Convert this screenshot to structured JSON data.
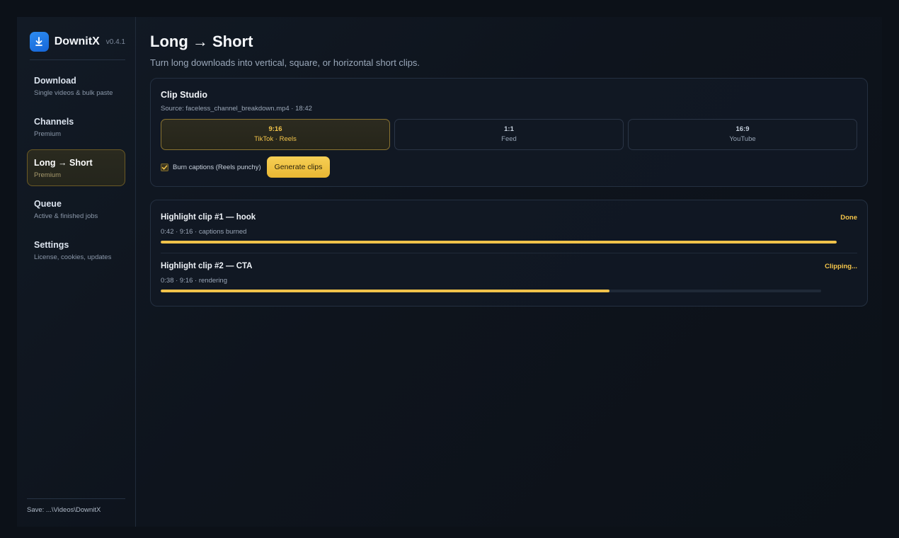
{
  "brand": {
    "name": "DownitX",
    "version": "v0.4.1",
    "logo_icon": "download-arrow-icon",
    "logo_color": "#1f7ae6"
  },
  "nav": {
    "items": [
      {
        "title": "Download",
        "subtitle": "Single videos & bulk paste",
        "active": false
      },
      {
        "title": "Channels",
        "subtitle": "Premium",
        "active": false
      },
      {
        "title": "Long → Short",
        "subtitle": "Premium",
        "active": true
      },
      {
        "title": "Queue",
        "subtitle": "Active & finished jobs",
        "active": false
      },
      {
        "title": "Settings",
        "subtitle": "License, cookies, updates",
        "active": false
      }
    ]
  },
  "footer": {
    "save_path": "Save: ...\\Videos\\DownitX"
  },
  "page": {
    "title": "Long → Short",
    "subtitle": "Turn long downloads into vertical, square, or horizontal short clips."
  },
  "studio": {
    "title": "Clip Studio",
    "source": "Source: faceless_channel_breakdown.mp4 · 18:42",
    "ratios": [
      {
        "value": "9:16",
        "label": "TikTok · Reels",
        "selected": true
      },
      {
        "value": "1:1",
        "label": "Feed",
        "selected": false
      },
      {
        "value": "16:9",
        "label": "YouTube",
        "selected": false
      }
    ],
    "captions": {
      "label": "Burn captions (Reels punchy)",
      "checked": true
    },
    "generate_label": "Generate clips"
  },
  "jobs": [
    {
      "title": "Highlight clip #1 — hook",
      "meta": "0:42 · 9:16 · captions burned",
      "status": "Done",
      "progress": 100
    },
    {
      "title": "Highlight clip #2 — CTA",
      "meta": "0:38 · 9:16 · rendering",
      "status": "Clipping...",
      "progress": 68
    }
  ],
  "colors": {
    "accent": "#f4c54a",
    "background": "#0c1118",
    "brand_blue": "#1f7ae6"
  }
}
